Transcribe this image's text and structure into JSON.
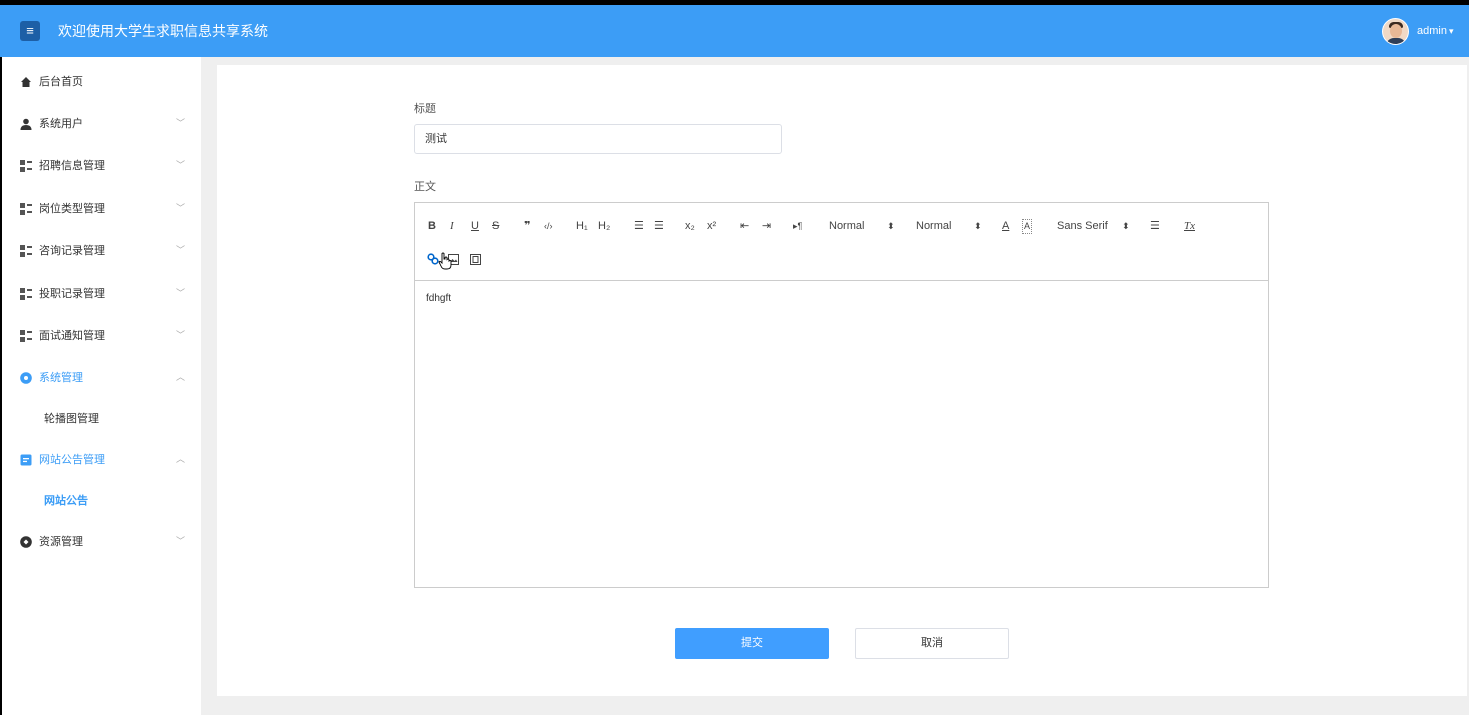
{
  "header": {
    "menu_icon": "≡",
    "title": "欢迎使用大学生求职信息共享系统",
    "user": "admin",
    "caret": "▾"
  },
  "sidebar": {
    "items": [
      {
        "label": "后台首页",
        "icon": "home-icon",
        "chevron": ""
      },
      {
        "label": "系统用户",
        "icon": "user-icon",
        "chevron": "﹀"
      },
      {
        "label": "招聘信息管理",
        "icon": "grid-icon",
        "chevron": "﹀"
      },
      {
        "label": "岗位类型管理",
        "icon": "grid-icon",
        "chevron": "﹀"
      },
      {
        "label": "咨询记录管理",
        "icon": "grid-icon",
        "chevron": "﹀"
      },
      {
        "label": "投职记录管理",
        "icon": "grid-icon",
        "chevron": "﹀"
      },
      {
        "label": "面试通知管理",
        "icon": "grid-icon",
        "chevron": "﹀"
      },
      {
        "label": "系统管理",
        "icon": "settings-icon",
        "chevron": "︿"
      },
      {
        "label": "网站公告管理",
        "icon": "document-icon",
        "chevron": "︿"
      },
      {
        "label": "资源管理",
        "icon": "resource-icon",
        "chevron": "﹀"
      }
    ],
    "sub_items": {
      "system": "轮播图管理",
      "notice": "网站公告"
    }
  },
  "form": {
    "title_label": "标题",
    "title_value": "测试",
    "body_label": "正文",
    "body_text": "fdhgft",
    "submit_label": "提交",
    "cancel_label": "取消"
  },
  "toolbar": {
    "bold": "B",
    "italic": "I",
    "underline": "U",
    "strike": "S",
    "quote": "❞",
    "code": "‹/›",
    "h1": "H₁",
    "h2": "H₂",
    "ordered": "☰",
    "bullet": "☰",
    "sub": "x₂",
    "sup": "x²",
    "outdent": "⇤",
    "indent": "⇥",
    "direction": "▸¶",
    "size_value": "Normal",
    "header_value": "Normal",
    "select_caret": "⬍",
    "color": "A",
    "background": "A",
    "font_value": "Sans Serif",
    "align": "☰",
    "clean": "Tx",
    "link": "🔗",
    "image": "▣",
    "video": "▤"
  },
  "colors": {
    "header_bg": "#3c9df6",
    "accent": "#409eff",
    "content_bg": "#efefef"
  }
}
